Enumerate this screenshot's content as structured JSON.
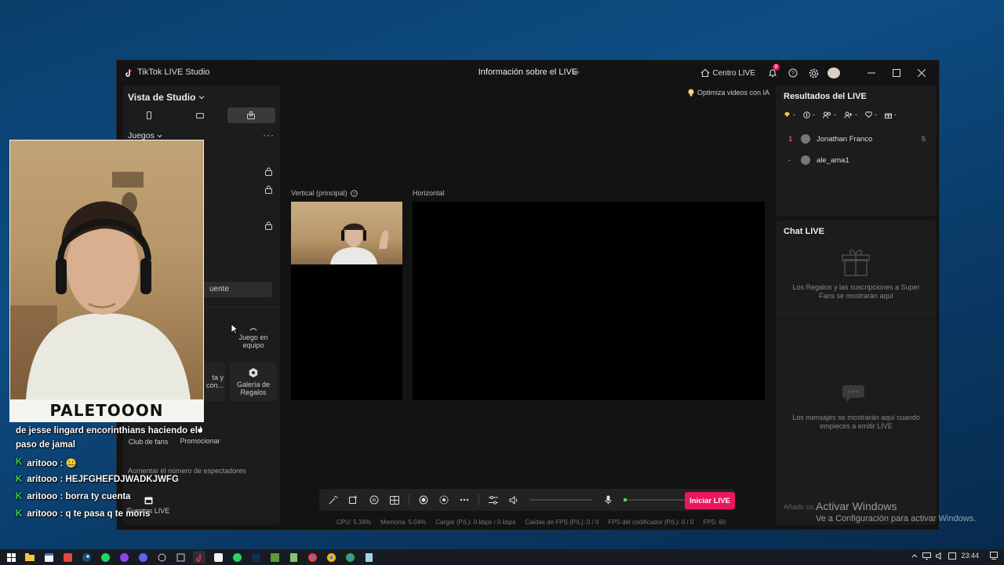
{
  "window": {
    "app_title": "TikTok LIVE Studio",
    "center_title": "Información sobre el LIVE",
    "centro_live": "Centro LIVE",
    "notif_count": "8"
  },
  "left_panel": {
    "view_label": "Vista de Studio",
    "section_label": "Juegos",
    "more": "···",
    "button_partial": "uente",
    "tiles": [
      {
        "label": "Juego en equipo"
      },
      {
        "label": "Galería de Regalos"
      },
      {
        "label": "ta y con..."
      },
      {
        "label": "Club de fans"
      },
      {
        "label": "Promocionar"
      },
      {
        "label": "Eventos LIVE"
      }
    ],
    "note": "Aumentar el número de espectadores"
  },
  "center": {
    "ai_chip": "Optimiza videos con IA",
    "vertical_label": "Vertical (principal)",
    "horizontal_label": "Horizontal"
  },
  "results": {
    "title": "Resultados del LIVE",
    "rows": [
      {
        "rank": "1",
        "name": "Jonathan Franco",
        "score": "5"
      },
      {
        "rank": "-",
        "name": "ale_ama1",
        "score": ""
      }
    ]
  },
  "chat": {
    "title": "Chat LIVE",
    "gifts_msg": "Los Regalos y las suscripciones a Super Fans se mostrarán aquí",
    "messages_msg": "Los mensajes se mostrarán aquí cuando empieces a emitir LIVE",
    "input_placeholder": "Añadir co..."
  },
  "toolbar": {
    "go_live": "Iniciar LIVE"
  },
  "stats": {
    "cpu": "CPU:  5.34%",
    "memory": "Memoria:  5.04%",
    "upload": "Cargar (P/L):  0 kbps / 0 kbps",
    "fps_drops": "Caídas de FPS (P/L):  0 / 0",
    "encoder": "FPS del codificador (P/L):  0 / 0",
    "fps": "FPS:  60"
  },
  "webcam": {
    "name": "PALETOOON"
  },
  "overlay_chat": [
    {
      "user": "",
      "text": "de jesse lingard encorinthians haciendo el"
    },
    {
      "user": "",
      "text": "paso de jamal"
    },
    {
      "user": "aritooo",
      "text": "aritooo : 🤐"
    },
    {
      "user": "aritooo",
      "text": "aritooo : HEJFGHEFDJWADKJWFG"
    },
    {
      "user": "aritooo",
      "text": "aritooo : borra ty cuenta"
    },
    {
      "user": "aritooo",
      "text": "aritooo : q te pasa q te moris"
    }
  ],
  "watermark": {
    "line1": "Activar Windows",
    "line2": "Ve a Configuración para activar Windows."
  },
  "taskbar": {
    "time": "23:44"
  },
  "colors": {
    "accent": "#e8185f",
    "rank": "#e04b6b",
    "chat_k": "#32d74b"
  }
}
